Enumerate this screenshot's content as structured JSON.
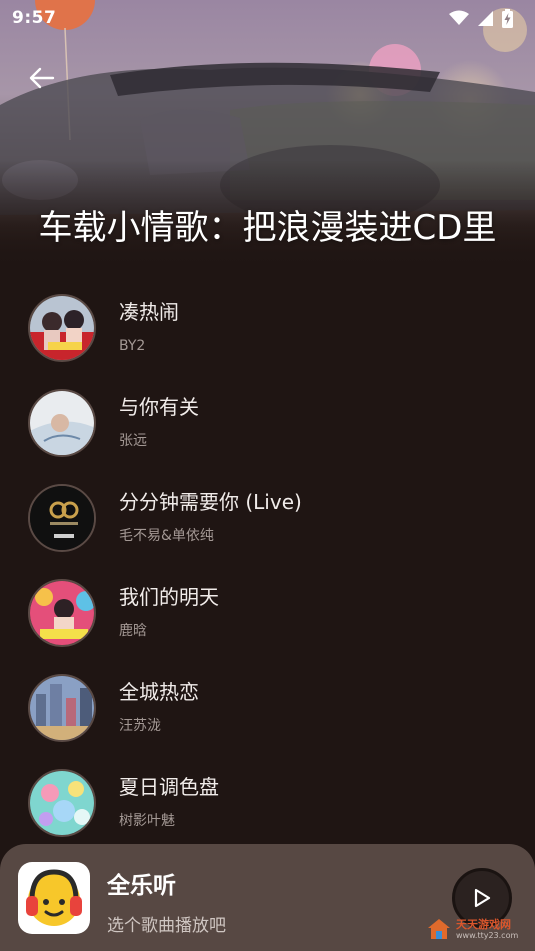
{
  "status_bar": {
    "time": "9:57",
    "icons": [
      "wifi-icon",
      "cellular-signal-icon",
      "battery-charging-icon"
    ]
  },
  "header": {
    "back_icon": "arrow-left-icon",
    "title": "车载小情歌：把浪漫装进CD里"
  },
  "songs": [
    {
      "title": "凑热闹",
      "artist": "BY2"
    },
    {
      "title": "与你有关",
      "artist": "张远"
    },
    {
      "title": "分分钟需要你 (Live)",
      "artist": "毛不易&单依纯"
    },
    {
      "title": "我们的明天",
      "artist": "鹿晗"
    },
    {
      "title": "全城热恋",
      "artist": "汪苏泷"
    },
    {
      "title": "夏日调色盘",
      "artist": "树影叶魅"
    }
  ],
  "mini_player": {
    "app_name": "全乐听",
    "hint": "选个歌曲播放吧",
    "play_icon": "play-icon"
  },
  "watermark": {
    "name": "天天游戏网",
    "url": "www.tty23.com"
  },
  "colors": {
    "background": "#1f1513",
    "player_background": "#574843",
    "text_primary": "#f1ecea",
    "text_secondary": "#a39894"
  }
}
